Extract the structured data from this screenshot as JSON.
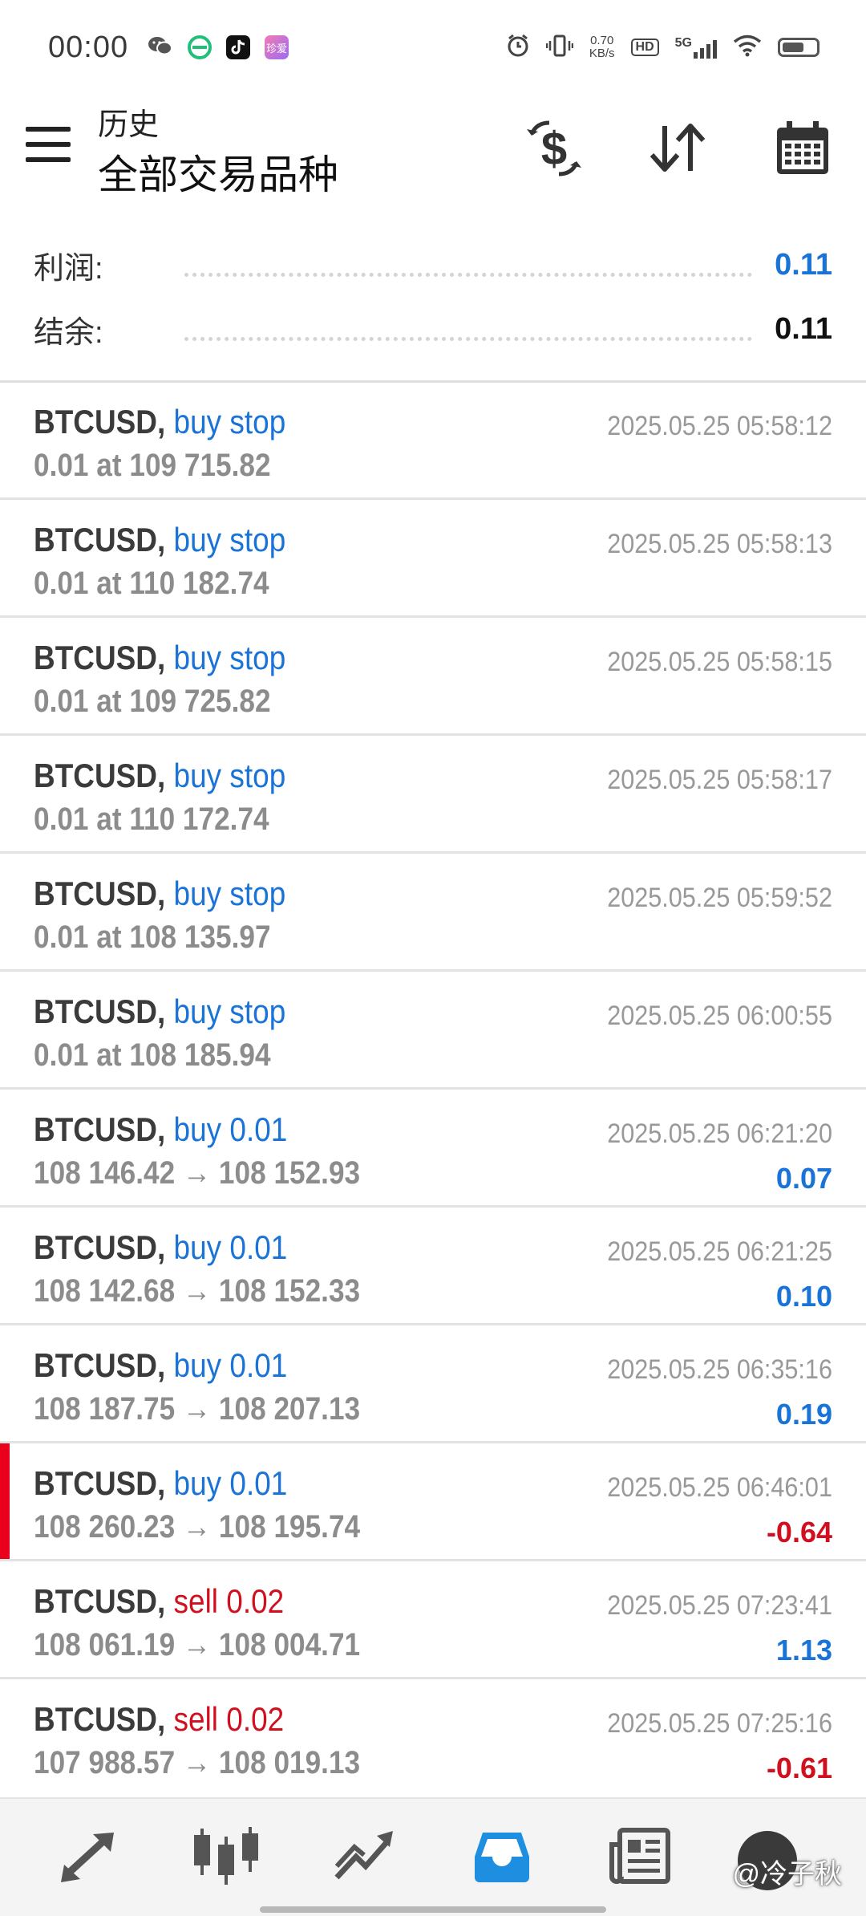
{
  "status_bar": {
    "time": "00:00",
    "net_speed_value": "0.70",
    "net_speed_unit": "KB/s",
    "hd_label": "HD",
    "network_label": "5G",
    "app_badge_label": "珍爱"
  },
  "header": {
    "subtitle": "历史",
    "title": "全部交易品种"
  },
  "summary": {
    "profit_label": "利润:",
    "profit_value": "0.11",
    "balance_label": "结余:",
    "balance_value": "0.11"
  },
  "trades": [
    {
      "symbol": "BTCUSD,",
      "action": "buy stop",
      "side": "buy",
      "detail": "0.01 at 109 715.82",
      "time": "2025.05.25 05:58:12",
      "profit": ""
    },
    {
      "symbol": "BTCUSD,",
      "action": "buy stop",
      "side": "buy",
      "detail": "0.01 at 110 182.74",
      "time": "2025.05.25 05:58:13",
      "profit": ""
    },
    {
      "symbol": "BTCUSD,",
      "action": "buy stop",
      "side": "buy",
      "detail": "0.01 at 109 725.82",
      "time": "2025.05.25 05:58:15",
      "profit": ""
    },
    {
      "symbol": "BTCUSD,",
      "action": "buy stop",
      "side": "buy",
      "detail": "0.01 at 110 172.74",
      "time": "2025.05.25 05:58:17",
      "profit": ""
    },
    {
      "symbol": "BTCUSD,",
      "action": "buy stop",
      "side": "buy",
      "detail": "0.01 at 108 135.97",
      "time": "2025.05.25 05:59:52",
      "profit": ""
    },
    {
      "symbol": "BTCUSD,",
      "action": "buy stop",
      "side": "buy",
      "detail": "0.01 at 108 185.94",
      "time": "2025.05.25 06:00:55",
      "profit": ""
    },
    {
      "symbol": "BTCUSD,",
      "action": "buy 0.01",
      "side": "buy",
      "detail": "108 146.42 → 108 152.93",
      "time": "2025.05.25 06:21:20",
      "profit": "0.07"
    },
    {
      "symbol": "BTCUSD,",
      "action": "buy 0.01",
      "side": "buy",
      "detail": "108 142.68 → 108 152.33",
      "time": "2025.05.25 06:21:25",
      "profit": "0.10"
    },
    {
      "symbol": "BTCUSD,",
      "action": "buy 0.01",
      "side": "buy",
      "detail": "108 187.75 → 108 207.13",
      "time": "2025.05.25 06:35:16",
      "profit": "0.19"
    },
    {
      "symbol": "BTCUSD,",
      "action": "buy 0.01",
      "side": "buy",
      "detail": "108 260.23 → 108 195.74",
      "time": "2025.05.25 06:46:01",
      "profit": "-0.64"
    },
    {
      "symbol": "BTCUSD,",
      "action": "sell 0.02",
      "side": "sell",
      "detail": "108 061.19 → 108 004.71",
      "time": "2025.05.25 07:23:41",
      "profit": "1.13"
    },
    {
      "symbol": "BTCUSD,",
      "action": "sell 0.02",
      "side": "sell",
      "detail": "107 988.57 → 108 019.13",
      "time": "2025.05.25 07:25:16",
      "profit": "-0.61"
    }
  ],
  "bottom_nav": {
    "items": [
      {
        "icon": "quotes-arrows-icon"
      },
      {
        "icon": "candlestick-chart-icon"
      },
      {
        "icon": "trend-chart-icon"
      },
      {
        "icon": "history-inbox-icon",
        "active": true
      },
      {
        "icon": "news-icon"
      }
    ],
    "watermark": "@冷子秋"
  },
  "colors": {
    "accent_blue": "#1a73d6",
    "loss_red": "#d0101e",
    "marker_red": "#e8001c"
  }
}
